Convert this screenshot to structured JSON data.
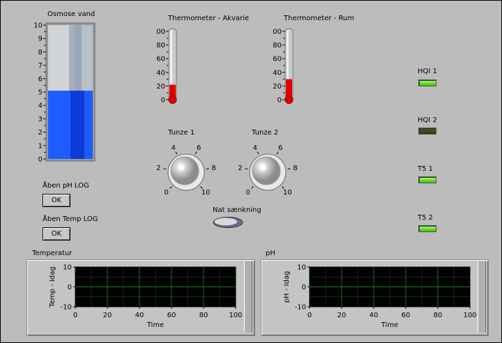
{
  "osmose": {
    "title": "Osmose vand",
    "scale": [
      "10",
      "9",
      "8",
      "7",
      "6",
      "5",
      "4",
      "3",
      "2",
      "1",
      "0"
    ],
    "level": 5.1
  },
  "thermo_akvarie": {
    "title": "Thermometer - Akvarie",
    "scale": [
      "100",
      "80",
      "60",
      "40",
      "20",
      "0"
    ],
    "level": 22
  },
  "thermo_rum": {
    "title": "Thermometer - Rum",
    "scale": [
      "100",
      "80",
      "60",
      "40",
      "20",
      "0"
    ],
    "level": 30
  },
  "tunze1": {
    "title": "Tunze 1",
    "ticks": [
      "0",
      "2",
      "4",
      "6",
      "8",
      "10"
    ]
  },
  "tunze2": {
    "title": "Tunze 2",
    "ticks": [
      "0",
      "2",
      "4",
      "6",
      "8",
      "10"
    ]
  },
  "ph_log": {
    "label": "Åben pH LOG",
    "button": "OK"
  },
  "temp_log": {
    "label": "Åben Temp LOG",
    "button": "OK"
  },
  "nat": {
    "label": "Nat sænkning"
  },
  "leds": [
    {
      "label": "HQI 1",
      "state": "on"
    },
    {
      "label": "HQI 2",
      "state": "off"
    },
    {
      "label": "T5 1",
      "state": "on"
    },
    {
      "label": "T5 2",
      "state": "on"
    }
  ],
  "graph_temp": {
    "title": "Temperatur",
    "ylabel": "Temp - Idag",
    "xlabel": "Time",
    "yticks": [
      "10",
      "0",
      "-10"
    ],
    "xticks": [
      "0",
      "20",
      "40",
      "60",
      "80",
      "100"
    ]
  },
  "graph_ph": {
    "title": "pH",
    "ylabel": "pH - Idag",
    "xlabel": "Time",
    "yticks": [
      "10",
      "0",
      "-10"
    ],
    "xticks": [
      "0",
      "20",
      "40",
      "60",
      "80",
      "100"
    ]
  },
  "colors": {
    "panel": "#bcbcbc",
    "tank_fill": "#1f5cff",
    "thermo_fill": "#e00000",
    "graph_bg": "#000000",
    "graph_grid": "#1f7a1f"
  }
}
